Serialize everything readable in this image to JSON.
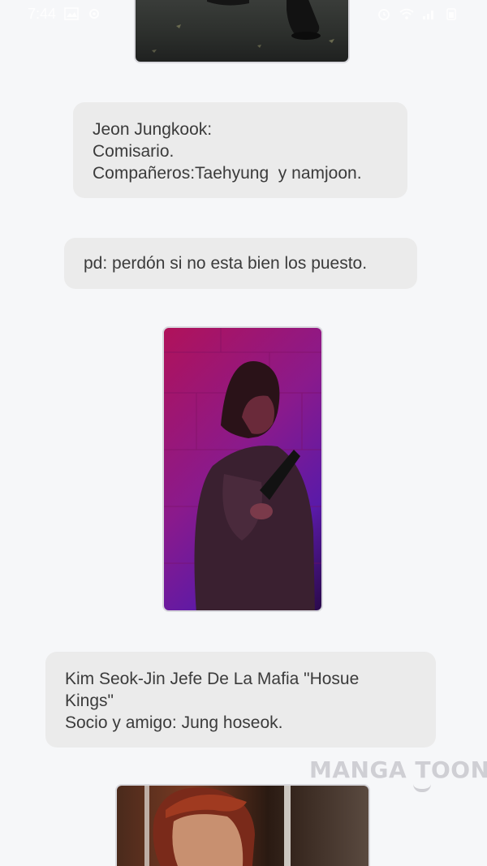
{
  "status_bar": {
    "time": "7:44",
    "left_icons": [
      "gallery-icon",
      "settings-gear-icon"
    ],
    "right_icons": [
      "alarm-icon",
      "wifi-icon",
      "signal-icon",
      "battery-icon"
    ]
  },
  "content": {
    "bubble_1": {
      "lines": [
        "Jeon Jungkook:",
        "Comisario.",
        "Compañeros:Taehyung  y namjoon."
      ]
    },
    "bubble_2": {
      "lines": [
        "pd: perdón si no esta bien los puesto."
      ]
    },
    "bubble_3": {
      "lines": [
        "Kim Seok-Jin Jefe De La Mafia \"Hosue",
        "Kings\"",
        "Socio y amigo: Jung hoseok."
      ]
    }
  },
  "watermark": {
    "text": "MANGA TOON"
  },
  "colors": {
    "background": "#f6f7f9",
    "bubble": "#ebebeb",
    "text": "#3b3b3b",
    "watermark": "#cfcfd4"
  }
}
